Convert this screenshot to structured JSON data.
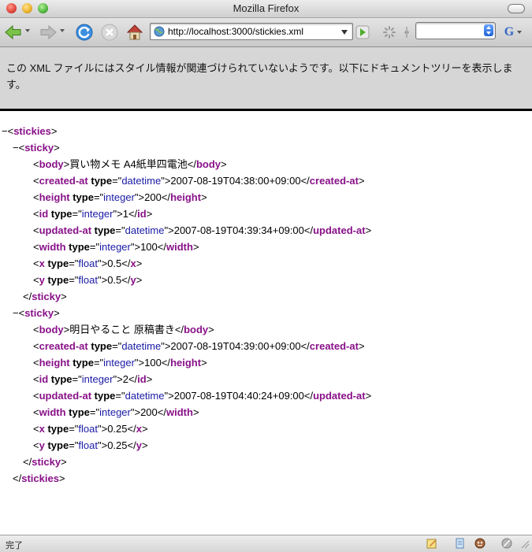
{
  "window": {
    "title": "Mozilla Firefox"
  },
  "toolbar": {
    "url": "http://localhost:3000/stickies.xml",
    "search_engine_label": "G"
  },
  "banner": {
    "message": "この XML ファイルにはスタイル情報が関連づけられていないようです。以下にドキュメントツリーを表示します。"
  },
  "tree": {
    "toggle_symbol": "−",
    "root_tag": "stickies",
    "item_tag": "sticky",
    "stickies": [
      {
        "fields": [
          {
            "tag": "body",
            "attr": "",
            "value_type": "",
            "text": "買い物メモ A4紙単四電池"
          },
          {
            "tag": "created-at",
            "attr": "type",
            "value_type": "datetime",
            "text": "2007-08-19T04:38:00+09:00"
          },
          {
            "tag": "height",
            "attr": "type",
            "value_type": "integer",
            "text": "200"
          },
          {
            "tag": "id",
            "attr": "type",
            "value_type": "integer",
            "text": "1"
          },
          {
            "tag": "updated-at",
            "attr": "type",
            "value_type": "datetime",
            "text": "2007-08-19T04:39:34+09:00"
          },
          {
            "tag": "width",
            "attr": "type",
            "value_type": "integer",
            "text": "100"
          },
          {
            "tag": "x",
            "attr": "type",
            "value_type": "float",
            "text": "0.5"
          },
          {
            "tag": "y",
            "attr": "type",
            "value_type": "float",
            "text": "0.5"
          }
        ]
      },
      {
        "fields": [
          {
            "tag": "body",
            "attr": "",
            "value_type": "",
            "text": "明日やること 原稿書き"
          },
          {
            "tag": "created-at",
            "attr": "type",
            "value_type": "datetime",
            "text": "2007-08-19T04:39:00+09:00"
          },
          {
            "tag": "height",
            "attr": "type",
            "value_type": "integer",
            "text": "100"
          },
          {
            "tag": "id",
            "attr": "type",
            "value_type": "integer",
            "text": "2"
          },
          {
            "tag": "updated-at",
            "attr": "type",
            "value_type": "datetime",
            "text": "2007-08-19T04:40:24+09:00"
          },
          {
            "tag": "width",
            "attr": "type",
            "value_type": "integer",
            "text": "200"
          },
          {
            "tag": "x",
            "attr": "type",
            "value_type": "float",
            "text": "0.25"
          },
          {
            "tag": "y",
            "attr": "type",
            "value_type": "float",
            "text": "0.25"
          }
        ]
      }
    ]
  },
  "statusbar": {
    "text": "完了"
  },
  "icons": {
    "back": "back-arrow-icon",
    "forward": "forward-arrow-icon",
    "reload": "reload-icon",
    "stop": "stop-icon",
    "home": "home-icon",
    "go": "go-arrow-icon",
    "throbber": "throbber-icon",
    "page_globe": "globe-icon"
  },
  "colors": {
    "tag": "#881188",
    "attr_value": "#1a1aa6",
    "banner_bg": "#d6d6d6"
  }
}
